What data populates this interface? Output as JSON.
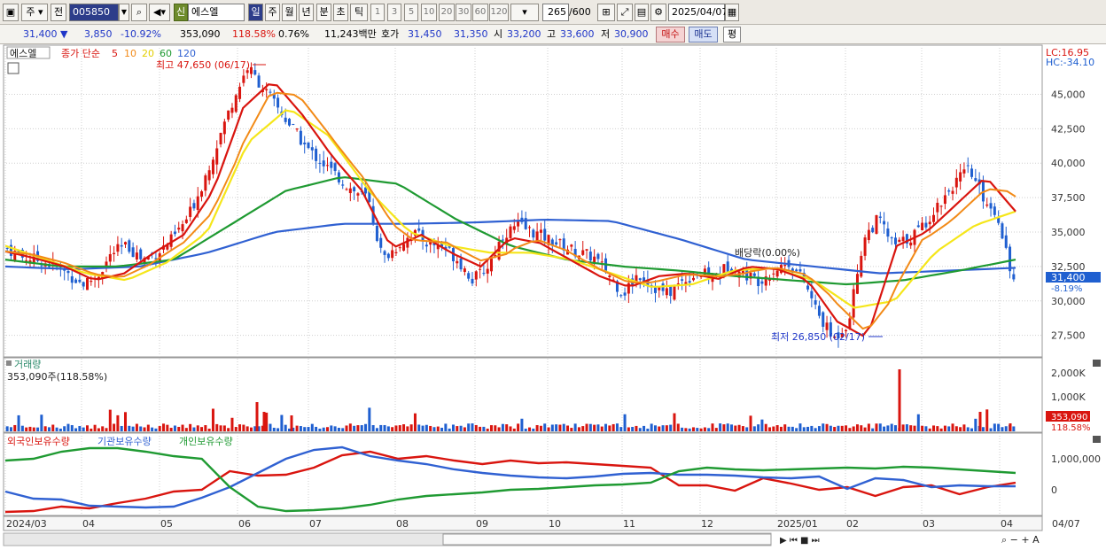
{
  "toolbar": {
    "period_button": "주",
    "prev_button": "전",
    "stock_code": "005850",
    "credit_badge": "신",
    "stock_name": "에스엘",
    "periods": [
      "일",
      "주",
      "월",
      "년",
      "분",
      "초",
      "틱"
    ],
    "selected_period": "일",
    "intervals": [
      "1",
      "3",
      "5",
      "10",
      "20",
      "30",
      "60",
      "120"
    ],
    "count": "265",
    "count_total": "/600",
    "date": "2025/04/07"
  },
  "infobar": {
    "price": "31,400",
    "change": "3,850",
    "change_pct": "-10.92%",
    "volume": "353,090",
    "volume_ratio": "118.58%",
    "turnover_pct": "0.76%",
    "amount": "11,243백만",
    "quote_label": "호가",
    "ask": "31,450",
    "bid": "31,350",
    "open_label": "시",
    "open": "33,200",
    "high_label": "고",
    "high": "33,600",
    "low_label": "저",
    "low": "30,900",
    "buy_button": "매수",
    "sell_button": "매도",
    "avg_button": "평"
  },
  "main_panel": {
    "name_tag": "에스엘",
    "legend_prefix": "종가 단순",
    "ma_labels": [
      "5",
      "10",
      "20",
      "60",
      "120"
    ],
    "high_annotation": "최고 47,650 (06/17)",
    "low_annotation": "최저 26,850 (02/17)",
    "dividend_annotation": "배당락(0.00%)",
    "lc_label": "LC:16.95",
    "hc_label": "HC:-34.10",
    "y_ticks": [
      "45,000",
      "42,500",
      "40,000",
      "37,500",
      "35,000",
      "32,500",
      "30,000",
      "27,500"
    ],
    "current_price_tag": "31,400",
    "current_change_tag": "-8.19%"
  },
  "volume_panel": {
    "title": "거래량",
    "value_text": "353,090주(118.58%)",
    "y_ticks": [
      "2,000K",
      "1,000K"
    ],
    "tag_value": "353,090",
    "tag_ratio": "118.58%"
  },
  "holdings_panel": {
    "legend": [
      "외국인보유수량",
      "기관보유수량",
      "개인보유수량"
    ],
    "y_ticks": [
      "1,000,000",
      "0"
    ]
  },
  "x_axis": {
    "labels": [
      "2024/03",
      "04",
      "05",
      "06",
      "07",
      "08",
      "09",
      "10",
      "11",
      "12",
      "2025/01",
      "02",
      "03",
      "04",
      "04/07"
    ]
  },
  "colors": {
    "ma5": "#d9150f",
    "ma10": "#f28a17",
    "ma20": "#f5e61a",
    "ma60": "#1f9a32",
    "ma120": "#3061d2",
    "up": "#d9150f",
    "down": "#1f5fd0"
  },
  "chart_data": {
    "type": "candlestick",
    "x_range": [
      "2024/03",
      "2025/04/07"
    ],
    "ylim": [
      26000,
      48500
    ],
    "close_approx": [
      33800,
      33200,
      33000,
      32600,
      32000,
      31200,
      31800,
      33500,
      34000,
      33000,
      33500,
      34500,
      36000,
      38500,
      41500,
      44500,
      47000,
      45500,
      44000,
      42500,
      41000,
      40000,
      39000,
      38000,
      37500,
      33000,
      34000,
      35000,
      34200,
      34000,
      33000,
      31500,
      32500,
      34800,
      35500,
      35000,
      34500,
      34000,
      33500,
      33200,
      32000,
      30500,
      32000,
      31000,
      30500,
      31500,
      32000,
      31800,
      32500,
      32000,
      31500,
      32200,
      32800,
      31500,
      29000,
      27200,
      28500,
      34500,
      36000,
      34000,
      34500,
      35500,
      37000,
      38500,
      39500,
      37500,
      36000,
      31400
    ],
    "ma5_approx": [
      33600,
      33100,
      32500,
      31500,
      32000,
      33500,
      34800,
      38000,
      44000,
      46000,
      43500,
      40500,
      38000,
      33800,
      34800,
      33500,
      32500,
      34600,
      34200,
      33000,
      31800,
      31000,
      31800,
      32000,
      31600,
      32500,
      32300,
      31500,
      28500,
      27300,
      34000,
      35000,
      37000,
      39000,
      36500
    ],
    "ma20_approx": [
      34000,
      33000,
      32000,
      31500,
      32800,
      35000,
      41500,
      44000,
      42000,
      38000,
      35000,
      34000,
      33500,
      33500,
      33000,
      32000,
      31000,
      31200,
      32200,
      32400,
      31500,
      29500,
      30000,
      33500,
      35500,
      36500
    ],
    "ma60_approx": [
      33000,
      32500,
      32500,
      33000,
      35500,
      38000,
      39000,
      38500,
      36000,
      34000,
      33000,
      32500,
      32200,
      31800,
      31500,
      31200,
      31500,
      32200,
      33000
    ],
    "ma120_approx": [
      32500,
      32300,
      32500,
      33500,
      35000,
      35600,
      35600,
      35700,
      35900,
      35800,
      34500,
      33000,
      32500,
      32000,
      32200,
      32400
    ]
  }
}
